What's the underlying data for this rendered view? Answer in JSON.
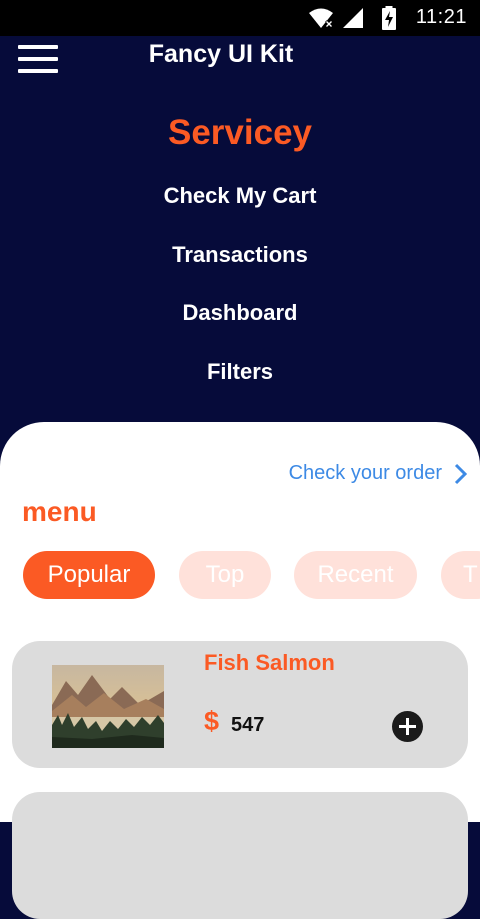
{
  "status_bar": {
    "time": "11:21",
    "icons": [
      "wifi-icon",
      "cell-signal-icon",
      "battery-charging-icon"
    ]
  },
  "app_bar": {
    "title": "Fancy UI Kit",
    "menu_icon": "hamburger-menu-icon"
  },
  "drawer": {
    "brand": "Servicey",
    "links": [
      "Check My Cart",
      "Transactions",
      "Dashboard",
      "Filters"
    ]
  },
  "content": {
    "check_order_label": "Check your order",
    "section_label": "menu",
    "tabs": [
      {
        "label": "Popular",
        "active": true
      },
      {
        "label": "Top",
        "active": false
      },
      {
        "label": "Recent",
        "active": false
      },
      {
        "label": "T",
        "active": false
      }
    ],
    "items": [
      {
        "name": "Fish Salmon",
        "currency": "$",
        "price": "547",
        "image": "mountain-lake-landscape"
      }
    ]
  },
  "colors": {
    "background": "#060b3a",
    "accent": "#fb5a24",
    "link": "#3d8ae5",
    "tab_inactive": "#ffe1da",
    "card": "#dcdcdc"
  }
}
